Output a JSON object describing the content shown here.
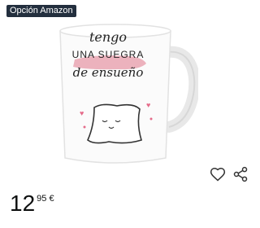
{
  "badge": {
    "label": "Opción Amazon"
  },
  "product": {
    "mug_text": {
      "line1": "tengo",
      "line2": "UNA SUEGRA",
      "line3": "de ensueño"
    },
    "image_icon": "mug-with-pillow-illustration"
  },
  "actions": {
    "wishlist_icon": "heart-outline-icon",
    "share_icon": "share-icon"
  },
  "price": {
    "whole": "12",
    "fraction": "95 €"
  },
  "colors": {
    "badge_bg": "#232f3e",
    "brush_pink": "#e79aa8",
    "heart_pink": "#e56b8a"
  }
}
